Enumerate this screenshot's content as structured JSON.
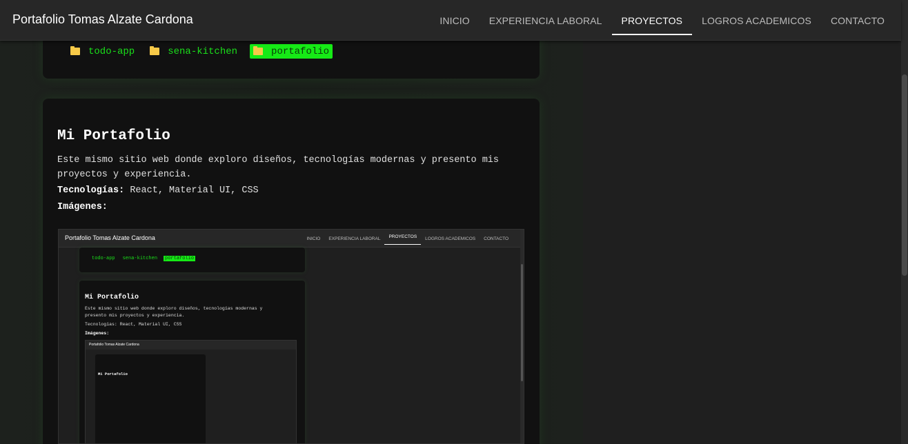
{
  "header": {
    "brand": "Portafolio Tomas Alzate Cardona",
    "nav": [
      "INICIO",
      "EXPERIENCIA LABORAL",
      "PROYECTOS",
      "LOGROS ACADEMICOS",
      "CONTACTO"
    ],
    "active_nav": "PROYECTOS"
  },
  "repos": {
    "items": [
      "todo-app",
      "sena-kitchen",
      "portafolio"
    ],
    "active": "portafolio"
  },
  "project": {
    "title": "Mi Portafolio",
    "description": "Este mismo sitio web donde exploro diseños, tecnologías modernas y presento mis proyectos y experiencia.",
    "tech_label": "Tecnologías:",
    "tech_value": " React, Material UI, CSS",
    "images_label": "Imágenes:"
  },
  "preview": {
    "brand": "Portafolio Tomas Alzate Cardona",
    "nav": [
      "INICIO",
      "EXPERIENCIA LABORAL",
      "PROYECTOS",
      "LOGROS ACADEMICOS",
      "CONTACTO"
    ],
    "folders": [
      "todo-app",
      "sena-kitchen",
      "portafolio"
    ],
    "title": "Mi Portafolio",
    "description": "Este mismo sitio web donde exploro diseños, tecnologías modernas y presento mis proyectos y experiencia.",
    "tech": "Tecnologías: React, Material UI, CSS",
    "images": "Imágenes:",
    "nested_brand": "Portafolio Tomas Alzate Cardona",
    "nested_title": "Mi Portafolio"
  },
  "colors": {
    "accent": "#16ea16",
    "folder": "#f7c948",
    "background": "#1f1f1f",
    "card": "#111111"
  }
}
